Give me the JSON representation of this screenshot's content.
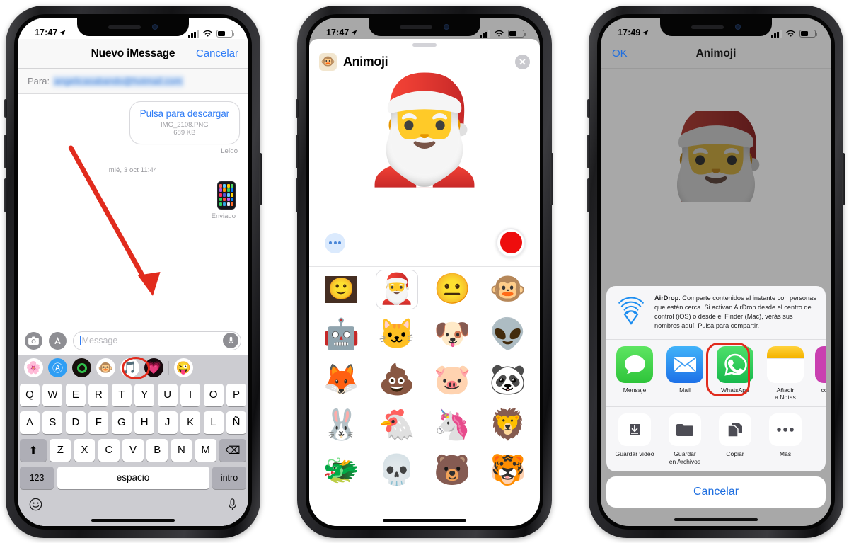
{
  "phone1": {
    "status": {
      "time": "17:47",
      "location_icon": "location-arrow-icon",
      "wifi_icon": "wifi-icon",
      "battery_icon": "battery-icon"
    },
    "navbar": {
      "title": "Nuevo iMessage",
      "cancel": "Cancelar"
    },
    "recipient": {
      "label": "Para:",
      "value": "angelicasabando@hotmail.com"
    },
    "bubble": {
      "main": "Pulsa para descargar",
      "filename": "IMG_2108.PNG",
      "filesize": "689 KB",
      "status": "Leído"
    },
    "timestamp": "mié, 3 oct 11:44",
    "sent": {
      "status": "Enviado"
    },
    "input": {
      "placeholder": "Message",
      "camera_icon": "camera-icon",
      "appstore_icon": "app-store-icon",
      "mic_icon": "microphone-icon"
    },
    "appdrawer": {
      "items": [
        {
          "name": "photos-app-icon",
          "glyph": "🌸"
        },
        {
          "name": "app-store-icon",
          "glyph": "Ⓐ"
        },
        {
          "name": "digital-touch-icon",
          "glyph": "◉"
        },
        {
          "name": "animoji-app-icon",
          "glyph": "🐵"
        },
        {
          "name": "music-app-icon",
          "glyph": "🎵"
        },
        {
          "name": "hearts-sticker-icon",
          "glyph": "💗"
        },
        {
          "name": "emoji-sticker-icon",
          "glyph": "😜"
        }
      ],
      "highlighted_index": 3
    },
    "keyboard": {
      "row1": [
        "Q",
        "W",
        "E",
        "R",
        "T",
        "Y",
        "U",
        "I",
        "O",
        "P"
      ],
      "row2": [
        "A",
        "S",
        "D",
        "F",
        "G",
        "H",
        "J",
        "K",
        "L",
        "Ñ"
      ],
      "row3_shift": "⬆",
      "row3": [
        "Z",
        "X",
        "C",
        "V",
        "B",
        "N",
        "M"
      ],
      "row3_backspace": "⌫",
      "numbers_key": "123",
      "space_key": "espacio",
      "enter_key": "intro",
      "emoji_key": "emoji-keyboard-icon",
      "dictation_key": "microphone-icon"
    }
  },
  "phone2": {
    "status": {
      "time": "17:47"
    },
    "sheet": {
      "title": "Animoji",
      "badge_glyph": "🐵",
      "close": "✕"
    },
    "preview": {
      "memoji_glyph": "🎅",
      "more_button": "more-options-icon",
      "record_button": "record-button"
    },
    "grid": [
      {
        "name": "memoji-camera-thumb",
        "glyph": "🙂",
        "selected": false,
        "thumb": true
      },
      {
        "name": "memoji-santa-glasses",
        "glyph": "🎅",
        "selected": true
      },
      {
        "name": "memoji-glasses",
        "glyph": "😐",
        "selected": false
      },
      {
        "name": "animoji-monkey",
        "glyph": "🐵",
        "selected": false
      },
      {
        "name": "animoji-robot",
        "glyph": "🤖",
        "selected": false
      },
      {
        "name": "animoji-cat",
        "glyph": "🐱",
        "selected": false
      },
      {
        "name": "animoji-dog",
        "glyph": "🐶",
        "selected": false
      },
      {
        "name": "animoji-alien",
        "glyph": "👽",
        "selected": false
      },
      {
        "name": "animoji-fox",
        "glyph": "🦊",
        "selected": false
      },
      {
        "name": "animoji-poop",
        "glyph": "💩",
        "selected": false
      },
      {
        "name": "animoji-pig",
        "glyph": "🐷",
        "selected": false
      },
      {
        "name": "animoji-panda",
        "glyph": "🐼",
        "selected": false
      },
      {
        "name": "animoji-rabbit",
        "glyph": "🐰",
        "selected": false
      },
      {
        "name": "animoji-chicken",
        "glyph": "🐔",
        "selected": false
      },
      {
        "name": "animoji-unicorn",
        "glyph": "🦄",
        "selected": false
      },
      {
        "name": "animoji-lion",
        "glyph": "🦁",
        "selected": false
      },
      {
        "name": "animoji-dragon",
        "glyph": "🐲",
        "selected": false
      },
      {
        "name": "animoji-skull",
        "glyph": "💀",
        "selected": false
      },
      {
        "name": "animoji-bear",
        "glyph": "🐻",
        "selected": false
      },
      {
        "name": "animoji-tiger",
        "glyph": "🐯",
        "selected": false
      }
    ]
  },
  "phone3": {
    "status": {
      "time": "17:49"
    },
    "navbar": {
      "left": "OK",
      "title": "Animoji"
    },
    "sharesheet": {
      "airdrop": {
        "icon": "airdrop-icon",
        "title": "AirDrop",
        "body": ". Comparte contenidos al instante con personas que estén cerca. Si activan AirDrop desde el centro de control (iOS) o desde el Finder (Mac), verás sus nombres aquí. Pulsa para compartir."
      },
      "apps": [
        {
          "name": "messages-app",
          "label": "Mensaje",
          "color": "#4cd964",
          "glyph": "💬",
          "highlighted": false
        },
        {
          "name": "mail-app",
          "label": "Mail",
          "color": "#2f9ef4",
          "glyph": "✉",
          "highlighted": false
        },
        {
          "name": "whatsapp-app",
          "label": "WhatsApp",
          "color": "#25d366",
          "glyph": "✆",
          "highlighted": true
        },
        {
          "name": "notes-app",
          "label": "Añadir\na Notas",
          "color": "#ffffff",
          "glyph": "📝",
          "highlighted": false
        },
        {
          "name": "more-app-partial",
          "label": "co",
          "color": "#c93fb0",
          "glyph": "",
          "highlighted": false
        }
      ],
      "actions": [
        {
          "name": "save-video-action",
          "label": "Guardar vídeo",
          "icon": "download-icon"
        },
        {
          "name": "save-to-files-action",
          "label": "Guardar\nen Archivos",
          "icon": "folder-icon"
        },
        {
          "name": "copy-action",
          "label": "Copiar",
          "icon": "copy-icon"
        },
        {
          "name": "more-action",
          "label": "Más",
          "icon": "ellipsis-icon"
        }
      ],
      "cancel": "Cancelar"
    }
  },
  "colors": {
    "ios_blue": "#2f7cf6",
    "highlight_red": "#e12b1d",
    "record_red": "#ee0d0d",
    "keyboard_bg": "#ccccd1",
    "dimmed_bg": "#a8a8a8"
  }
}
